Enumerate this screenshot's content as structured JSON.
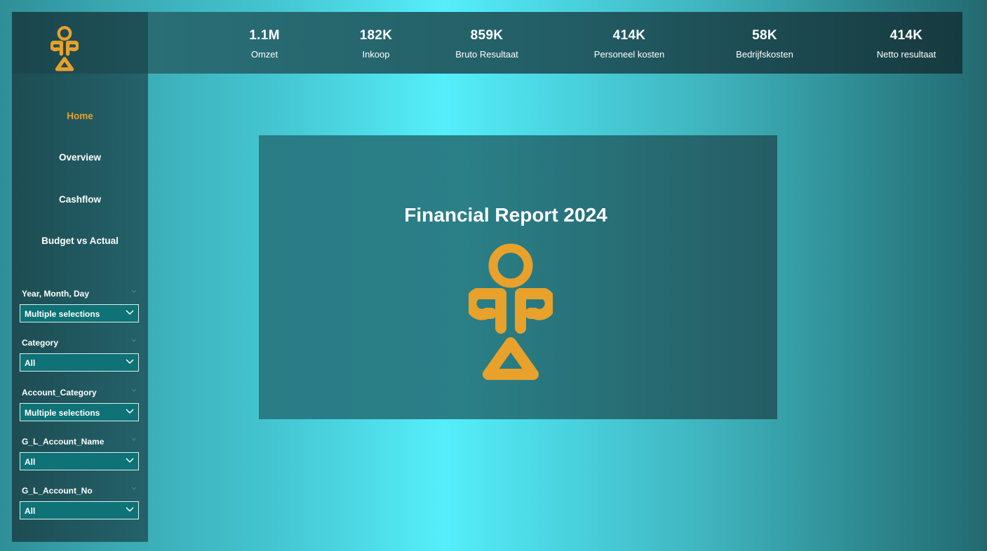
{
  "colors": {
    "accent": "#e8a12a",
    "panel": "#1f5158",
    "slicer_bg": "#0e7276",
    "text": "#ffffff"
  },
  "nav": {
    "items": [
      {
        "label": "Home",
        "active": true
      },
      {
        "label": "Overview",
        "active": false
      },
      {
        "label": "Cashflow",
        "active": false
      },
      {
        "label": "Budget vs Actual",
        "active": false
      }
    ]
  },
  "kpis": [
    {
      "value": "1.1M",
      "label": "Omzet"
    },
    {
      "value": "182K",
      "label": "Inkoop"
    },
    {
      "value": "859K",
      "label": "Bruto Resultaat"
    },
    {
      "value": "414K",
      "label": "Personeel kosten"
    },
    {
      "value": "58K",
      "label": "Bedrijfskosten"
    },
    {
      "value": "414K",
      "label": "Netto resultaat"
    }
  ],
  "slicers": [
    {
      "label": "Year, Month, Day",
      "value": "Multiple selections"
    },
    {
      "label": "Category",
      "value": "All"
    },
    {
      "label": "Account_Category",
      "value": "Multiple selections"
    },
    {
      "label": "G_L_Account_Name",
      "value": "All"
    },
    {
      "label": "G_L_Account_No",
      "value": "All"
    }
  ],
  "card": {
    "title": "Financial Report 2024"
  },
  "icons": {
    "logo": "figure-logo-icon",
    "dropdown": "chevron-down-icon"
  }
}
